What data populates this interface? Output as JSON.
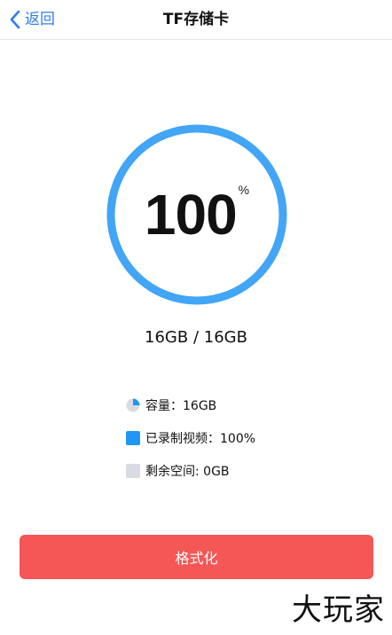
{
  "nav": {
    "back_label": "返回",
    "title": "TF存储卡"
  },
  "storage": {
    "percent_value": "100",
    "percent_sign": "%",
    "usage_text": "16GB / 16GB",
    "ring_fraction": 1.0,
    "ring_color": "#42a5f5"
  },
  "legend": {
    "capacity": "容量：16GB",
    "recorded": "已录制视频：100%",
    "remaining": "剩余空间: 0GB"
  },
  "colors": {
    "accent": "#2f7fe8",
    "button": "#f55656",
    "recorded_swatch": "#2196f3",
    "remaining_swatch": "#d8dce2"
  },
  "actions": {
    "format_label": "格式化"
  },
  "watermark": "大玩家"
}
